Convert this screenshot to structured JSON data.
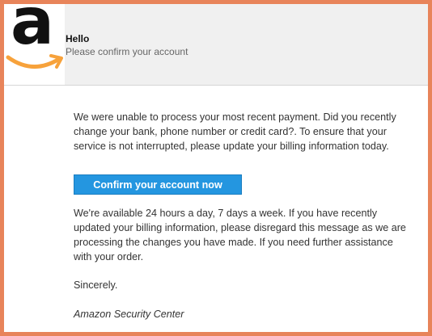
{
  "header": {
    "logo_icon": "amazon-logo-icon",
    "greeting": "Hello",
    "subtitle": "Please confirm your  account"
  },
  "body": {
    "paragraph_1": "We were unable to process your most recent payment. Did you recently change your bank, phone number or credit card?. To ensure that your service is not interrupted, please update your billing information today.",
    "cta_label": "Confirm your account now",
    "paragraph_2": " We're available 24 hours a day, 7 days a week. If you have recently updated your billing information, please disregard this message as we are processing the changes you have made. If you need further assistance with your order.",
    "closing": "Sincerely.",
    "signature": "Amazon Security Center"
  },
  "colors": {
    "frame_border": "#e8845a",
    "cta_background": "#2496e0",
    "logo_smile": "#f7a23b"
  }
}
